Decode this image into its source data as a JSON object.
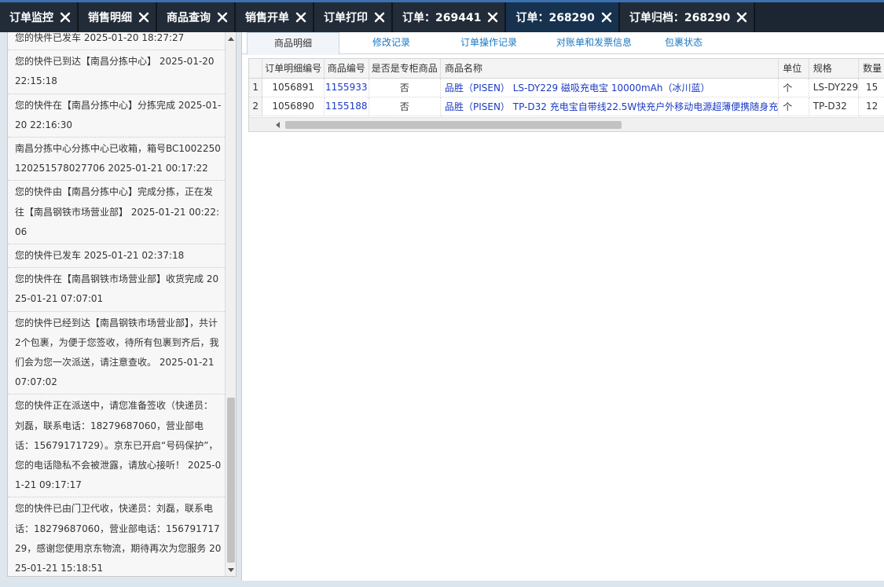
{
  "top_tabs": [
    {
      "label": "订单监控",
      "active": false
    },
    {
      "label": "销售明细",
      "active": false
    },
    {
      "label": "商品查询",
      "active": false
    },
    {
      "label": "销售开单",
      "active": false
    },
    {
      "label": "订单打印",
      "active": false
    },
    {
      "label": "订单：269441",
      "active": false
    },
    {
      "label": "订单：268290",
      "active": true
    },
    {
      "label": "订单归档：268290",
      "active": false
    }
  ],
  "logistics_log": [
    "您的快件已发车 2025-01-20 18:27:27",
    "您的快件已到达【南昌分拣中心】 2025-01-20 22:15:18",
    "您的快件在【南昌分拣中心】分拣完成 2025-01-20 22:16:30",
    "南昌分拣中心分拣中心已收箱，箱号BC1002250120251578027706 2025-01-21 00:17:22",
    "您的快件由【南昌分拣中心】完成分拣，正在发往【南昌钢铁市场营业部】 2025-01-21 00:22:06",
    "您的快件已发车 2025-01-21 02:37:18",
    "您的快件在【南昌钢铁市场营业部】收货完成 2025-01-21 07:07:01",
    "您的快件已经到达【南昌钢铁市场营业部】，共计2个包裹，为便于您签收，待所有包裹到齐后，我们会为您一次派送，请注意查收。 2025-01-21 07:07:02",
    "您的快件正在派送中，请您准备签收（快递员：刘磊，联系电话：18279687060，营业部电话：15679171729）。京东已开启“号码保护”，您的电话隐私不会被泄露，请放心接听！ 2025-01-21 09:17:17",
    "您的快件已由门卫代收，快递员：刘磊，联系电话：18279687060，营业部电话：15679171729，感谢您使用京东物流，期待再次为您服务 2025-01-21 15:18:51"
  ],
  "sub_tabs": [
    {
      "label": "商品明细",
      "active": true
    },
    {
      "label": "修改记录",
      "active": false
    },
    {
      "label": "订单操作记录",
      "active": false
    },
    {
      "label": "对账单和发票信息",
      "active": false
    },
    {
      "label": "包裹状态",
      "active": false
    }
  ],
  "grid": {
    "columns": [
      "订单明细编号",
      "商品编号",
      "是否是专柜商品",
      "商品名称",
      "单位",
      "规格",
      "数量"
    ],
    "rows": [
      {
        "row_no": "1",
        "detail_id": "1056891",
        "product_id": "1155933",
        "is_counter": "否",
        "product_name": "品胜（PISEN） LS-DY229 磁吸充电宝 10000mAh（冰川蓝）",
        "unit": "个",
        "spec": "LS-DY229",
        "qty": "15"
      },
      {
        "row_no": "2",
        "detail_id": "1056890",
        "product_id": "1155188",
        "is_counter": "否",
        "product_name": "品胜（PISEN） TP-D32 充电宝自带线22.5W快充户外移动电源超薄便携随身充",
        "unit": "个",
        "spec": "TP-D32",
        "qty": "12"
      }
    ]
  },
  "colors": {
    "topbar_bg": "#1c2633",
    "active_tab_bg": "#17324f",
    "link_blue": "#1c3ac4",
    "subtab_blue": "#1a78c2"
  }
}
